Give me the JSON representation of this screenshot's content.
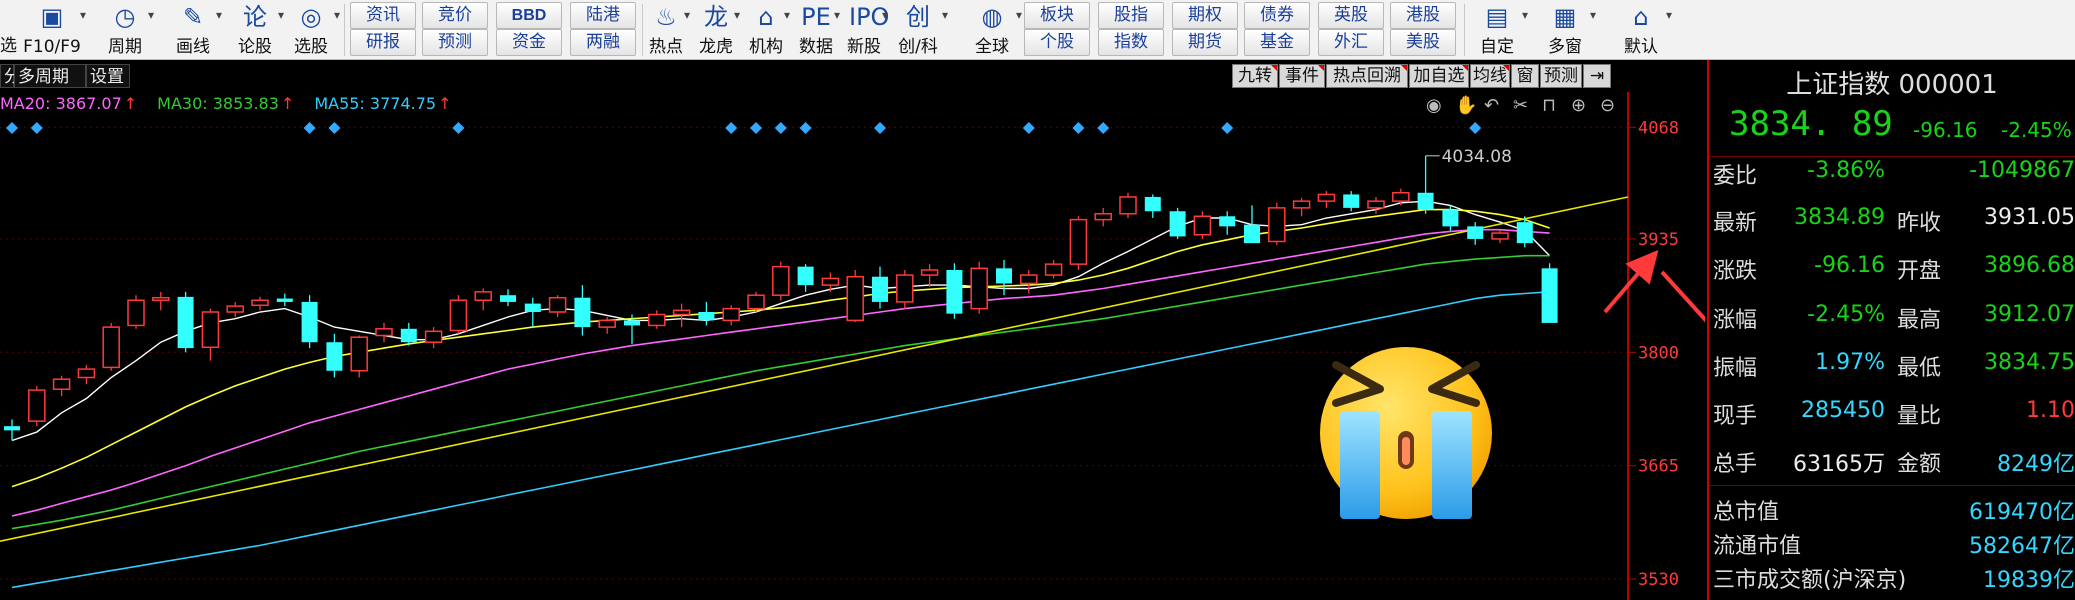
{
  "toolbar": {
    "groups": [
      {
        "icon": "panel-icon",
        "glyph": "▣",
        "label": "F10/F9"
      },
      {
        "icon": "clock-icon",
        "glyph": "◷",
        "label": "周期"
      },
      {
        "icon": "pen-icon",
        "glyph": "✎",
        "label": "画线"
      },
      {
        "icon": "discuss-icon",
        "glyph": "论",
        "label": "论股"
      },
      {
        "icon": "magnifier-icon",
        "glyph": "◎",
        "label": "选股"
      }
    ],
    "buttons": [
      [
        "资讯",
        "研报"
      ],
      [
        "竞价",
        "预测"
      ],
      [
        "BBD",
        "资金"
      ],
      [
        "陆港",
        "两融"
      ]
    ],
    "groups2": [
      {
        "icon": "hot-icon",
        "glyph": "♨",
        "label": "热点"
      },
      {
        "icon": "dragon-icon",
        "glyph": "龙",
        "label": "龙虎"
      },
      {
        "icon": "bank-icon",
        "glyph": "⌂",
        "label": "机构"
      },
      {
        "icon": "pe-icon",
        "glyph": "PE",
        "label": "数据"
      },
      {
        "icon": "ipo-icon",
        "glyph": "IPO",
        "label": "新股"
      },
      {
        "icon": "chuang-icon",
        "glyph": "创",
        "label": "创/科"
      },
      {
        "icon": "globe-icon",
        "glyph": "◍",
        "label": "全球"
      }
    ],
    "buttons2": [
      [
        "板块",
        "个股"
      ],
      [
        "股指",
        "指数"
      ],
      [
        "期权",
        "期货"
      ],
      [
        "债券",
        "基金"
      ],
      [
        "英股",
        "外汇"
      ],
      [
        "港股",
        "美股"
      ]
    ],
    "groups3": [
      {
        "icon": "custom-icon",
        "glyph": "▤",
        "label": "自定"
      },
      {
        "icon": "multiwindow-icon",
        "glyph": "▦",
        "label": "多窗"
      },
      {
        "icon": "home-icon",
        "glyph": "⌂",
        "label": "默认"
      }
    ],
    "left_edge_label": "选"
  },
  "left_tabs": [
    "分",
    "多周期",
    "设置"
  ],
  "right_tabs": [
    "九转",
    "事件",
    "热点回溯",
    "加自选",
    "均线",
    "窗",
    "预测",
    "⇥"
  ],
  "ma_legend": [
    {
      "label": "MA20: 3867.07",
      "arrow": "↑",
      "color": "#ff66ff"
    },
    {
      "label": "MA30: 3853.83",
      "arrow": "↑",
      "color": "#33cc33"
    },
    {
      "label": "MA55: 3774.75",
      "arrow": "↑",
      "color": "#33ccff"
    }
  ],
  "chart_icons": [
    "eye-icon",
    "hand-icon",
    "undo-icon",
    "scissors-icon",
    "lock-icon",
    "zoom-in-icon",
    "zoom-out-icon"
  ],
  "chart_data": {
    "type": "candlestick",
    "y_ticks": [
      4068,
      3935,
      3800,
      3665,
      3530
    ],
    "ylim": [
      3505,
      4110
    ],
    "peak_annotation": "4034.08",
    "candles": [
      [
        3712,
        3720,
        3695,
        3707
      ],
      [
        3718,
        3760,
        3712,
        3755
      ],
      [
        3756,
        3772,
        3748,
        3768
      ],
      [
        3770,
        3785,
        3762,
        3780
      ],
      [
        3782,
        3835,
        3778,
        3830
      ],
      [
        3832,
        3868,
        3828,
        3862
      ],
      [
        3862,
        3872,
        3850,
        3865
      ],
      [
        3866,
        3872,
        3800,
        3805
      ],
      [
        3806,
        3852,
        3790,
        3848
      ],
      [
        3848,
        3860,
        3842,
        3855
      ],
      [
        3856,
        3866,
        3850,
        3862
      ],
      [
        3864,
        3870,
        3855,
        3860
      ],
      [
        3860,
        3868,
        3805,
        3812
      ],
      [
        3812,
        3822,
        3770,
        3778
      ],
      [
        3778,
        3820,
        3770,
        3818
      ],
      [
        3820,
        3835,
        3812,
        3828
      ],
      [
        3828,
        3835,
        3808,
        3812
      ],
      [
        3812,
        3830,
        3805,
        3825
      ],
      [
        3826,
        3868,
        3822,
        3862
      ],
      [
        3862,
        3876,
        3850,
        3872
      ],
      [
        3868,
        3875,
        3855,
        3860
      ],
      [
        3858,
        3865,
        3830,
        3848
      ],
      [
        3848,
        3868,
        3842,
        3865
      ],
      [
        3865,
        3880,
        3820,
        3830
      ],
      [
        3830,
        3842,
        3822,
        3838
      ],
      [
        3838,
        3845,
        3810,
        3832
      ],
      [
        3832,
        3850,
        3828,
        3845
      ],
      [
        3845,
        3858,
        3830,
        3850
      ],
      [
        3848,
        3860,
        3832,
        3838
      ],
      [
        3838,
        3856,
        3832,
        3852
      ],
      [
        3852,
        3872,
        3848,
        3868
      ],
      [
        3868,
        3908,
        3862,
        3902
      ],
      [
        3902,
        3905,
        3872,
        3880
      ],
      [
        3880,
        3895,
        3872,
        3888
      ],
      [
        3838,
        3898,
        3836,
        3890
      ],
      [
        3890,
        3902,
        3852,
        3860
      ],
      [
        3860,
        3898,
        3852,
        3892
      ],
      [
        3892,
        3905,
        3878,
        3898
      ],
      [
        3898,
        3906,
        3840,
        3846
      ],
      [
        3852,
        3908,
        3846,
        3900
      ],
      [
        3900,
        3910,
        3868,
        3882
      ],
      [
        3882,
        3898,
        3870,
        3892
      ],
      [
        3892,
        3910,
        3888,
        3905
      ],
      [
        3905,
        3962,
        3898,
        3958
      ],
      [
        3958,
        3972,
        3950,
        3965
      ],
      [
        3965,
        3990,
        3960,
        3985
      ],
      [
        3985,
        3988,
        3960,
        3968
      ],
      [
        3968,
        3972,
        3935,
        3938
      ],
      [
        3940,
        3968,
        3935,
        3962
      ],
      [
        3962,
        3968,
        3940,
        3950
      ],
      [
        3952,
        3975,
        3930,
        3930
      ],
      [
        3932,
        3978,
        3928,
        3972
      ],
      [
        3972,
        3984,
        3962,
        3980
      ],
      [
        3980,
        3992,
        3972,
        3988
      ],
      [
        3988,
        3992,
        3968,
        3972
      ],
      [
        3972,
        3985,
        3965,
        3980
      ],
      [
        3980,
        3995,
        3975,
        3990
      ],
      [
        3990,
        4034,
        3965,
        3970
      ],
      [
        3970,
        3975,
        3945,
        3950
      ],
      [
        3950,
        3955,
        3928,
        3935
      ],
      [
        3935,
        3946,
        3930,
        3942
      ],
      [
        3955,
        3962,
        3925,
        3930
      ],
      [
        3900,
        3906,
        3835,
        3835
      ]
    ],
    "ma_lines": [
      {
        "name": "MA5",
        "color": "#ffffff",
        "values": [
          3695,
          3705,
          3728,
          3745,
          3770,
          3790,
          3812,
          3825,
          3835,
          3840,
          3848,
          3852,
          3842,
          3830,
          3825,
          3820,
          3815,
          3815,
          3822,
          3832,
          3842,
          3850,
          3852,
          3850,
          3844,
          3838,
          3838,
          3840,
          3838,
          3842,
          3848,
          3858,
          3868,
          3875,
          3880,
          3876,
          3878,
          3880,
          3880,
          3878,
          3876,
          3876,
          3880,
          3890,
          3906,
          3920,
          3935,
          3950,
          3960,
          3960,
          3952,
          3950,
          3952,
          3960,
          3965,
          3970,
          3978,
          3980,
          3975,
          3964,
          3955,
          3945,
          3915
        ]
      },
      {
        "name": "MA10",
        "color": "#ffff33",
        "values": [
          3640,
          3650,
          3662,
          3675,
          3690,
          3705,
          3720,
          3735,
          3748,
          3760,
          3770,
          3780,
          3788,
          3795,
          3800,
          3805,
          3810,
          3814,
          3818,
          3822,
          3826,
          3830,
          3833,
          3836,
          3838,
          3840,
          3842,
          3844,
          3846,
          3848,
          3850,
          3853,
          3857,
          3862,
          3866,
          3870,
          3873,
          3875,
          3877,
          3878,
          3879,
          3880,
          3882,
          3886,
          3892,
          3900,
          3910,
          3920,
          3928,
          3934,
          3940,
          3944,
          3948,
          3953,
          3958,
          3962,
          3966,
          3970,
          3970,
          3968,
          3964,
          3958,
          3948
        ]
      },
      {
        "name": "MA20",
        "color": "#ff66ff",
        "values": [
          3605,
          3612,
          3620,
          3628,
          3636,
          3645,
          3655,
          3665,
          3676,
          3686,
          3696,
          3706,
          3716,
          3724,
          3732,
          3740,
          3748,
          3756,
          3764,
          3772,
          3780,
          3786,
          3792,
          3798,
          3803,
          3808,
          3812,
          3816,
          3820,
          3824,
          3828,
          3832,
          3836,
          3840,
          3844,
          3848,
          3852,
          3855,
          3858,
          3861,
          3864,
          3866,
          3868,
          3872,
          3876,
          3881,
          3886,
          3891,
          3896,
          3901,
          3906,
          3911,
          3916,
          3921,
          3926,
          3931,
          3936,
          3941,
          3944,
          3946,
          3946,
          3944,
          3942
        ]
      },
      {
        "name": "MA30",
        "color": "#33cc33",
        "values": [
          3590,
          3595,
          3600,
          3606,
          3612,
          3619,
          3626,
          3633,
          3640,
          3647,
          3654,
          3661,
          3668,
          3675,
          3682,
          3688,
          3694,
          3700,
          3706,
          3712,
          3718,
          3724,
          3730,
          3736,
          3742,
          3748,
          3754,
          3760,
          3766,
          3772,
          3778,
          3783,
          3788,
          3793,
          3798,
          3803,
          3808,
          3812,
          3816,
          3820,
          3824,
          3828,
          3832,
          3836,
          3840,
          3845,
          3850,
          3855,
          3860,
          3865,
          3870,
          3875,
          3880,
          3885,
          3890,
          3895,
          3900,
          3905,
          3908,
          3911,
          3913,
          3915,
          3915
        ]
      },
      {
        "name": "MA55",
        "color": "#33ccff",
        "values": [
          3520,
          3525,
          3530,
          3535,
          3540,
          3545,
          3550,
          3555,
          3560,
          3565,
          3570,
          3576,
          3582,
          3588,
          3594,
          3600,
          3606,
          3612,
          3618,
          3624,
          3630,
          3636,
          3642,
          3648,
          3654,
          3660,
          3666,
          3672,
          3678,
          3684,
          3690,
          3696,
          3702,
          3708,
          3714,
          3720,
          3726,
          3732,
          3738,
          3744,
          3750,
          3756,
          3762,
          3768,
          3774,
          3780,
          3786,
          3792,
          3798,
          3804,
          3810,
          3816,
          3822,
          3828,
          3834,
          3840,
          3846,
          3852,
          3858,
          3864,
          3868,
          3870,
          3872
        ]
      },
      {
        "name": "MA120",
        "color": "#e6e600",
        "values": [
          3590,
          3597,
          3604,
          3611,
          3618,
          3625,
          3632,
          3639,
          3646,
          3653,
          3660,
          3667,
          3674,
          3681,
          3688,
          3695,
          3702,
          3709,
          3716,
          3723,
          3730,
          3737,
          3744,
          3751,
          3758,
          3765,
          3772,
          3779,
          3786,
          3793,
          3800,
          3807,
          3814,
          3821,
          3828,
          3835,
          3842,
          3849,
          3856,
          3863,
          3870,
          3877,
          3884,
          3891,
          3898,
          3905,
          3912,
          3919,
          3926,
          3933,
          3940,
          3947,
          3954,
          3961,
          3968,
          3975,
          3982,
          3989,
          3996,
          4003,
          4010,
          4017,
          4024
        ]
      }
    ],
    "event_markers": [
      0,
      1,
      12,
      13,
      18,
      29,
      30,
      31,
      32,
      35,
      41,
      43,
      44,
      49
    ]
  },
  "panel": {
    "title": "上证指数 000001",
    "price": "3834. 89",
    "change": "-96.16",
    "change_pct": "-2.45%",
    "rows": [
      {
        "l1": "委比",
        "v1": "-3.86%",
        "c1": "green",
        "l2": "",
        "v2": "-1049867",
        "c2": "green"
      },
      {
        "l1": "最新",
        "v1": "3834.89",
        "c1": "green",
        "l2": "昨收",
        "v2": "3931.05",
        "c2": "white"
      },
      {
        "l1": "涨跌",
        "v1": "-96.16",
        "c1": "green",
        "l2": "开盘",
        "v2": "3896.68",
        "c2": "green"
      },
      {
        "l1": "涨幅",
        "v1": "-2.45%",
        "c1": "green",
        "l2": "最高",
        "v2": "3912.07",
        "c2": "green"
      },
      {
        "l1": "振幅",
        "v1": "1.97%",
        "c1": "cyan",
        "l2": "最低",
        "v2": "3834.75",
        "c2": "green"
      },
      {
        "l1": "现手",
        "v1": "285450",
        "c1": "cyan",
        "l2": "量比",
        "v2": "1.10",
        "c2": "red"
      },
      {
        "l1": "总手",
        "v1": "63165万",
        "c1": "white",
        "l2": "金额",
        "v2": "8249亿",
        "c2": "cyan"
      }
    ],
    "stats": [
      {
        "label": "总市值",
        "value": "619470亿"
      },
      {
        "label": "流通市值",
        "value": "582647亿"
      },
      {
        "label": "三市成交额(沪深京)",
        "value": "19839亿"
      }
    ]
  }
}
